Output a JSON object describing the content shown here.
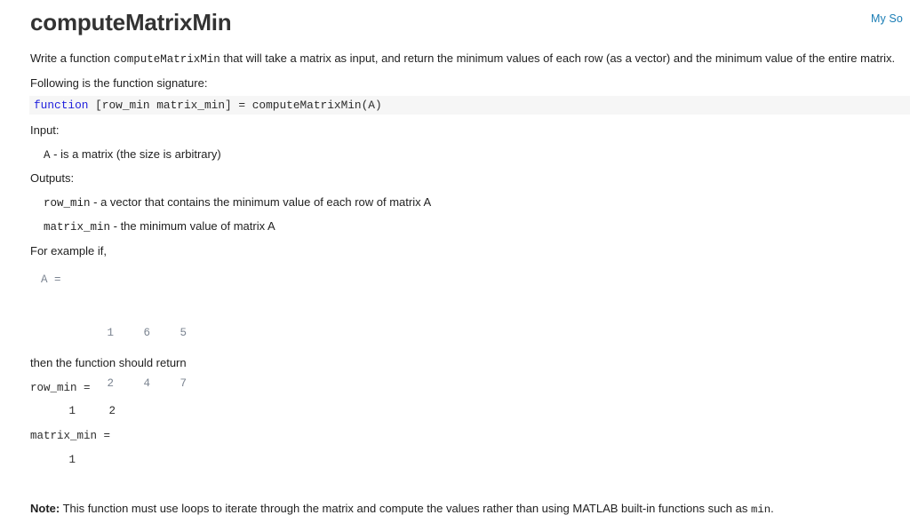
{
  "header": {
    "title": "computeMatrixMin",
    "my_solutions_link": "My So"
  },
  "body": {
    "intro_before_code": "Write a function ",
    "intro_code": "computeMatrixMin",
    "intro_after_code": " that will take a matrix as input, and return the minimum values of each row (as a vector) and the minimum value of the entire matrix.",
    "signature_intro": "Following is the function signature:",
    "signature_keyword": "function",
    "signature_rest": " [row_min matrix_min] = computeMatrixMin(A)",
    "input_label": "Input:",
    "input_item_code": "A",
    "input_item_text": " - is a matrix (the size is arbitrary)",
    "outputs_label": "Outputs:",
    "output_row_min_code": "row_min",
    "output_row_min_text": " - a vector that contains the minimum value of each row of matrix A",
    "output_matrix_min_code": "matrix_min",
    "output_matrix_min_text": " - the minimum value of matrix A",
    "example_intro": "For example if,",
    "example_var_label": "A =",
    "then_text": "then the function should return",
    "result_row_min_label": "row_min =",
    "result_matrix_min_label": "matrix_min ="
  },
  "example": {
    "matrix": [
      [
        "1",
        "6",
        "5"
      ],
      [
        "2",
        "4",
        "7"
      ]
    ],
    "row_min": [
      "1",
      "2"
    ],
    "matrix_min": [
      "1"
    ]
  },
  "note": {
    "label": "Note:",
    "text_before_code": " This function must use loops to iterate through the matrix and compute the values rather than using MATLAB built-in functions such as ",
    "code": "min",
    "text_after_code": "."
  },
  "colors": {
    "link": "#1a7db5",
    "keyword": "#2222dd",
    "code_background": "#f6f6f6",
    "matrix_text": "#7b8491",
    "heading": "#333333"
  }
}
